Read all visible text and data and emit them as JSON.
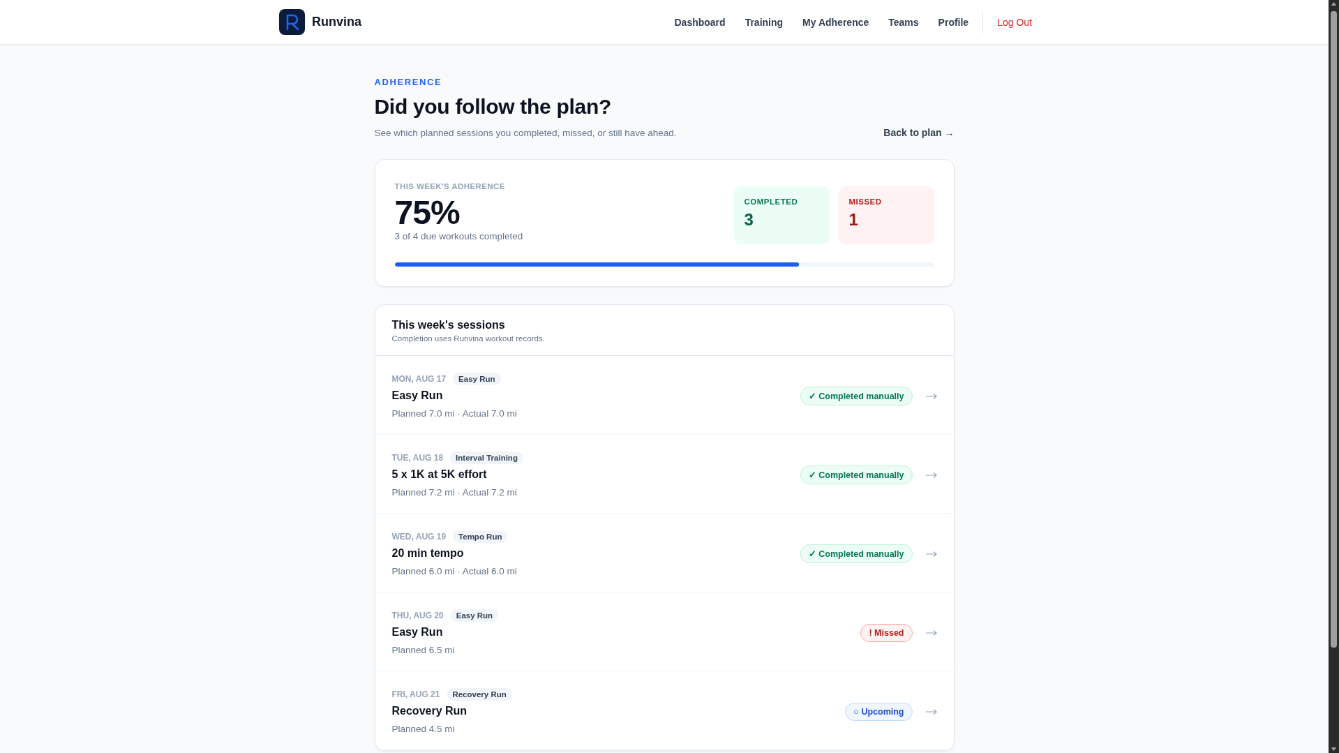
{
  "header": {
    "brand": "Runvina",
    "nav": [
      {
        "label": "Dashboard",
        "kind": "link"
      },
      {
        "label": "Training",
        "kind": "link"
      },
      {
        "label": "My Adherence",
        "kind": "link"
      },
      {
        "label": "Teams",
        "kind": "link"
      },
      {
        "label": "Profile",
        "kind": "link"
      },
      {
        "label": "Log Out",
        "kind": "logout"
      }
    ]
  },
  "page": {
    "eyebrow": "ADHERENCE",
    "title": "Did you follow the plan?",
    "subtitle": "See which planned sessions you completed, missed, or still have ahead.",
    "back_link": "Back to plan →"
  },
  "summary": {
    "label": "THIS WEEK'S ADHERENCE",
    "percent": "75%",
    "caption": "3 of 4 due workouts completed",
    "level": 0.75,
    "stats": [
      {
        "label": "COMPLETED",
        "value": "3",
        "kind": "completed"
      },
      {
        "label": "MISSED",
        "value": "1",
        "kind": "missed"
      }
    ]
  },
  "sessions": {
    "title": "This week's sessions",
    "note": "Completion uses Runvina workout records.",
    "items": [
      {
        "date": "MON, AUG 17",
        "type": "Easy Run",
        "name": "Easy Run",
        "detail": "Planned 7.0 mi · Actual 7.0 mi",
        "status": "✓ Completed manually",
        "kind": "completed"
      },
      {
        "date": "TUE, AUG 18",
        "type": "Interval Training",
        "name": "5 x 1K at 5K effort",
        "detail": "Planned 7.2 mi · Actual 7.2 mi",
        "status": "✓ Completed manually",
        "kind": "completed"
      },
      {
        "date": "WED, AUG 19",
        "type": "Tempo Run",
        "name": "20 min tempo",
        "detail": "Planned 6.0 mi · Actual 6.0 mi",
        "status": "✓ Completed manually",
        "kind": "completed"
      },
      {
        "date": "THU, AUG 20",
        "type": "Easy Run",
        "name": "Easy Run",
        "detail": "Planned 6.5 mi",
        "status": "! Missed",
        "kind": "missed"
      },
      {
        "date": "FRI, AUG 21",
        "type": "Recovery Run",
        "name": "Recovery Run",
        "detail": "Planned 4.5 mi",
        "status": "○ Upcoming",
        "kind": "upcoming"
      }
    ]
  }
}
